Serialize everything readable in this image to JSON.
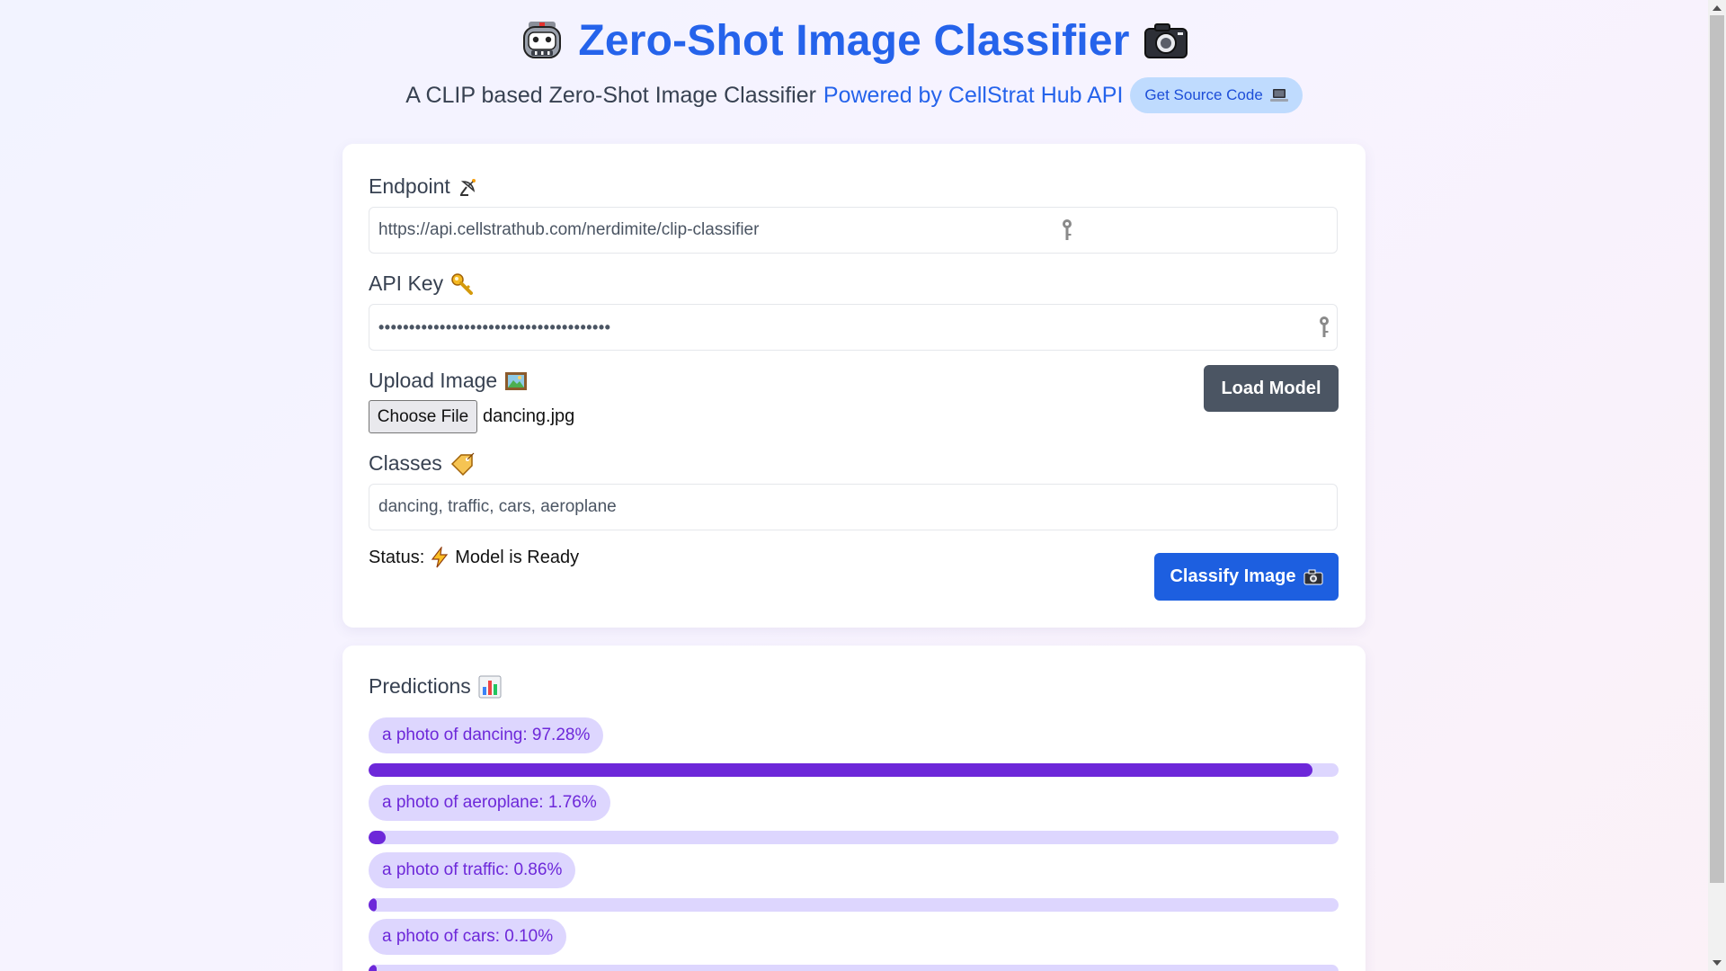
{
  "header": {
    "title": "Zero-Shot Image Classifier",
    "subtitle": "A CLIP based Zero-Shot Image Classifier",
    "powered_link": "Powered by CellStrat Hub API",
    "source_button": "Get Source Code"
  },
  "form": {
    "endpoint_label": "Endpoint",
    "endpoint_value": "https://api.cellstrathub.com/nerdimite/clip-classifier",
    "api_key_label": "API Key",
    "api_key_masked": "••••••••••••••••••••••••••••••••••••••",
    "upload_label": "Upload Image",
    "choose_file_label": "Choose File",
    "file_name": "dancing.jpg",
    "load_model_button": "Load Model",
    "classes_label": "Classes",
    "classes_value": "dancing, traffic, cars, aeroplane",
    "status_label": "Status:",
    "status_value": "Model is Ready",
    "classify_button": "Classify Image"
  },
  "predictions": {
    "title": "Predictions",
    "items": [
      {
        "label": "a photo of dancing: 97.28%",
        "value": 97.28
      },
      {
        "label": "a photo of aeroplane: 1.76%",
        "value": 1.76
      },
      {
        "label": "a photo of traffic: 0.86%",
        "value": 0.86
      },
      {
        "label": "a photo of cars: 0.10%",
        "value": 0.1
      }
    ]
  },
  "colors": {
    "accent": "#2563eb",
    "bar_fill": "#6d28d9",
    "bar_track": "#ddd6fe",
    "load_button": "#4b5563",
    "classify_button": "#1d5fe0"
  },
  "icons": {
    "title_left": "robot-icon",
    "title_right": "camera-icon",
    "source": "laptop-icon",
    "endpoint": "satellite-dish-icon",
    "api_key": "key-icon",
    "upload": "framed-picture-icon",
    "classes": "label-tag-icon",
    "status": "lightning-icon",
    "classify": "camera-icon",
    "predictions": "bar-chart-icon"
  }
}
